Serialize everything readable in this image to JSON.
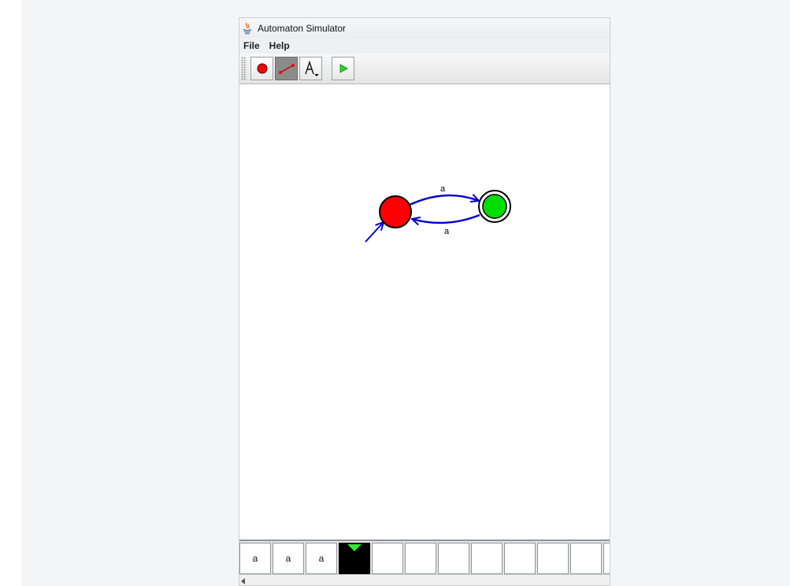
{
  "window": {
    "title": "Automaton Simulator"
  },
  "menu": {
    "items": [
      "File",
      "Help"
    ]
  },
  "toolbar": {
    "tools": [
      {
        "icon": "add-state-icon",
        "selected": false
      },
      {
        "icon": "add-transition-icon",
        "selected": true
      },
      {
        "icon": "alphabet-dropdown-icon",
        "label": "A",
        "selected": false
      },
      {
        "icon": "run-play-icon",
        "selected": false
      }
    ]
  },
  "automaton": {
    "states": [
      {
        "id": "q0",
        "color": "#ff0000",
        "initial": true,
        "accepting": false
      },
      {
        "id": "q1",
        "color": "#00dd00",
        "initial": false,
        "accepting": true
      }
    ],
    "transitions": [
      {
        "from": "q0",
        "to": "q1",
        "label": "a"
      },
      {
        "from": "q1",
        "to": "q0",
        "label": "a"
      }
    ],
    "edge_color": "#0000cc"
  },
  "tape": {
    "cells": [
      "a",
      "a",
      "a",
      "",
      "",
      "",
      "",
      "",
      "",
      "",
      "",
      ""
    ],
    "head_index": 3,
    "head_color": "#32e832"
  }
}
